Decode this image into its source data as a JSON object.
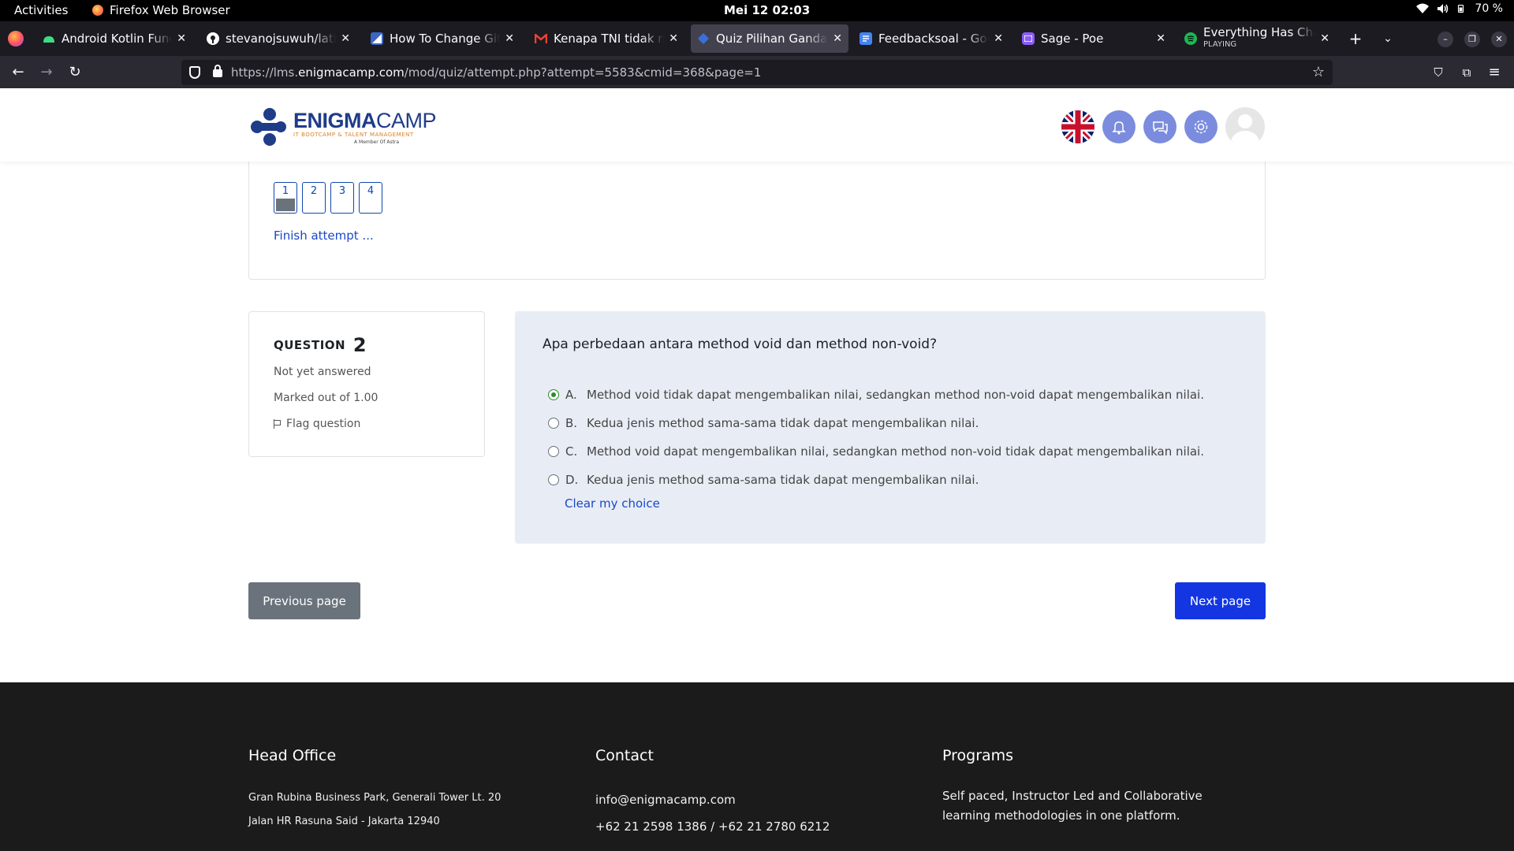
{
  "system_bar": {
    "activities": "Activities",
    "app_name": "Firefox Web Browser",
    "clock": "Mei 12  02:03",
    "battery": "70 %"
  },
  "tabs": [
    {
      "title": "Android Kotlin Fundamentals",
      "favicon": "android-icon",
      "color": "#3ddc84"
    },
    {
      "title": "stevanojsuwuh/latihan",
      "favicon": "github-icon",
      "color": "#ffffff"
    },
    {
      "title": "How To Change Git Remote",
      "favicon": "page-icon",
      "color": "#3b66c4"
    },
    {
      "title": "Kenapa TNI tidak menyerang",
      "favicon": "gmail-icon",
      "color": "#ea4335"
    },
    {
      "title": "Quiz Pilihan Ganda Fungsi",
      "favicon": "enigma-icon",
      "color": "#1f3c88"
    },
    {
      "title": "Feedbacksoal - Google Docs",
      "favicon": "docs-icon",
      "color": "#4285f4"
    },
    {
      "title": "Sage - Poe",
      "favicon": "poe-icon",
      "color": "#8b5cf6"
    },
    {
      "title": "Everything Has Changed",
      "subtitle": "PLAYING",
      "favicon": "spotify-icon",
      "color": "#1db954"
    }
  ],
  "urlbar": {
    "url_prefix": "https://lms.",
    "url_domain": "enigmacamp.com",
    "url_path": "/mod/quiz/attempt.php?attempt=5583&cmid=368&page=1"
  },
  "brand": {
    "name_bold": "ENIGMA",
    "name_light": "CAMP",
    "tagline": "IT BOOTCAMP & TALENT MANAGEMENT",
    "member": "A Member Of  Astra",
    "primary_color": "#1f3c88"
  },
  "quiz_nav": {
    "buttons": [
      "1",
      "2",
      "3",
      "4"
    ],
    "finish_link": "Finish attempt ..."
  },
  "question": {
    "label": "QUESTION",
    "number": "2",
    "state": "Not yet answered",
    "grade": "Marked out of 1.00",
    "flag_label": "Flag question",
    "text": "Apa perbedaan antara method void dan method non-void?",
    "answers": [
      {
        "letter": "A.",
        "text": "Method void tidak dapat mengembalikan nilai, sedangkan method non-void dapat mengembalikan nilai.",
        "selected": true
      },
      {
        "letter": "B.",
        "text": "Kedua jenis method sama-sama tidak dapat mengembalikan nilai.",
        "selected": false
      },
      {
        "letter": "C.",
        "text": "Method void dapat mengembalikan nilai, sedangkan method non-void tidak dapat mengembalikan nilai.",
        "selected": false
      },
      {
        "letter": "D.",
        "text": "Kedua jenis method sama-sama tidak dapat mengembalikan nilai.",
        "selected": false
      }
    ],
    "clear_choice": "Clear my choice"
  },
  "buttons": {
    "previous": "Previous page",
    "next": "Next page"
  },
  "footer": {
    "head_office": {
      "title": "Head Office",
      "line1": "Gran Rubina Business Park, Generali Tower Lt. 20",
      "line2": "Jalan HR Rasuna Said - Jakarta 12940"
    },
    "contact": {
      "title": "Contact",
      "email": "info@enigmacamp.com",
      "phone": "+62 21 2598 1386 / +62 21 2780 6212"
    },
    "programs": {
      "title": "Programs",
      "text": "Self paced, Instructor Led and Collaborative learning methodologies in one platform."
    }
  }
}
